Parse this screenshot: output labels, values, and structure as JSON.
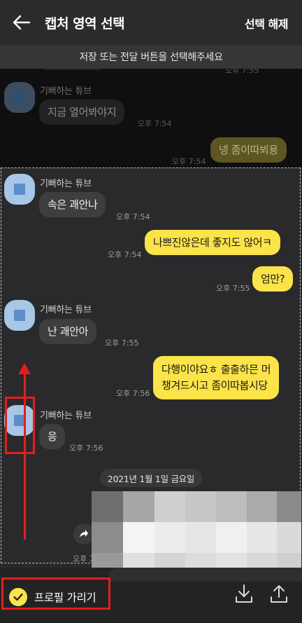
{
  "header": {
    "title": "캡처 영역 선택",
    "deselect_label": "선택 해제"
  },
  "notice": "저장 또는 전달 버튼을 선택해주세요",
  "messages": [
    {
      "type": "time",
      "time": "오후 7:55"
    },
    {
      "type": "in",
      "sender": "기뻐하는 튜브",
      "text": "지금 열어봐야지",
      "time": "오후 7:54"
    },
    {
      "type": "out",
      "text": "넹 좀이따뵈용",
      "time": "오후 7:54"
    },
    {
      "type": "in",
      "sender": "기뻐하는 튜브",
      "text": "속은 괘안나",
      "time": "오후 7:54"
    },
    {
      "type": "out",
      "text": "나쁘진않은데 좋지도 않어ㅋ",
      "time": "오후 7:54"
    },
    {
      "type": "out",
      "text": "엄만?",
      "time": "오후 7:55"
    },
    {
      "type": "in",
      "sender": "기뻐하는 튜브",
      "text": "난 괘안아",
      "time": "오후 7:55"
    },
    {
      "type": "out",
      "text_line1": "다행이야요ㅎ 출출하믄 머",
      "text_line2": "챙겨드시고 좀이따봅시당",
      "time": "오후 7:56"
    },
    {
      "type": "in",
      "sender": "기뻐하는 튜브",
      "text": "응",
      "time": "오후 7:56"
    },
    {
      "type": "time",
      "time": "오후 7"
    }
  ],
  "date_divider": "2021년 1월 1일 금요일",
  "bottom": {
    "hide_profile_label": "프로필 가리기",
    "hide_profile_checked": true
  },
  "icons": [
    "back-arrow-icon",
    "checkmark-icon",
    "download-icon",
    "share-icon",
    "forward-icon"
  ],
  "colors": {
    "bubble_out": "#fbe34a",
    "bubble_in": "#3e3e41",
    "highlight": "#e51d1d",
    "check": "#fbe34a"
  }
}
